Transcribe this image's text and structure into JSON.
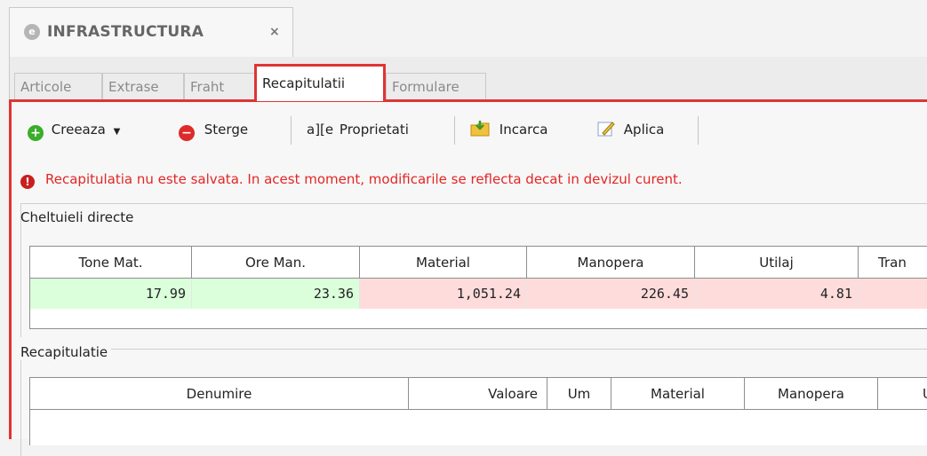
{
  "document_tab": {
    "title": "INFRASTRUCTURA",
    "close": "×"
  },
  "tabs": [
    "Articole",
    "Extrase",
    "Fraht",
    "Recapitulatii",
    "Formulare"
  ],
  "toolbar": {
    "create": "Creeaza",
    "delete": "Sterge",
    "properties_icon": "a][e",
    "properties": "Proprietati",
    "load": "Incarca",
    "apply": "Aplica"
  },
  "warning": "Recapitulatia nu este salvata. In acest moment, modificarile se reflecta decat in devizul curent.",
  "direct_costs": {
    "title": "Cheltuieli directe",
    "headers": [
      "Tone Mat.",
      "Ore Man.",
      "Material",
      "Manopera",
      "Utilaj",
      "Tran"
    ],
    "values": [
      "17.99",
      "23.36",
      "1,051.24",
      "226.45",
      "4.81",
      ""
    ]
  },
  "recap": {
    "title": "Recapitulatie",
    "headers": [
      "Denumire",
      "Valoare",
      "Um",
      "Material",
      "Manopera",
      "U"
    ]
  },
  "colors": {
    "active_tab_border": "#e03434",
    "warning_text": "#e32626",
    "cell_green": "#dbffdb",
    "cell_pink": "#ffdcdc"
  }
}
